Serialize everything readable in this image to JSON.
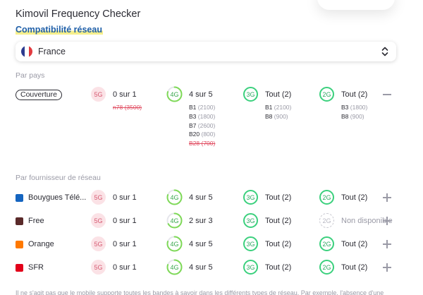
{
  "header": {
    "title": "Kimovil Frequency Checker",
    "subtitle": "Compatibilité réseau"
  },
  "country_select": {
    "value": "France",
    "flag_colors": [
      "#2d3b8f",
      "#ffffff",
      "#e23a3f"
    ]
  },
  "by_country": {
    "section_label": "Par pays",
    "coverage_button": "Couverture",
    "g5": {
      "badge": "5G",
      "stat": "0 sur 1",
      "bands": [
        {
          "name": "n78",
          "freq": "(3500)",
          "missing": true
        }
      ]
    },
    "g4": {
      "badge": "4G",
      "stat": "4 sur 5",
      "progress": 0.8,
      "bands": [
        {
          "name": "B1",
          "freq": "(2100)",
          "missing": false
        },
        {
          "name": "B3",
          "freq": "(1800)",
          "missing": false
        },
        {
          "name": "B7",
          "freq": "(2600)",
          "missing": false
        },
        {
          "name": "B20",
          "freq": "(800)",
          "missing": false
        },
        {
          "name": "B28",
          "freq": "(700)",
          "missing": true
        }
      ]
    },
    "g3": {
      "badge": "3G",
      "stat": "Tout (2)",
      "bands": [
        {
          "name": "B1",
          "freq": "(2100)",
          "missing": false
        },
        {
          "name": "B8",
          "freq": "(900)",
          "missing": false
        }
      ]
    },
    "g2": {
      "badge": "2G",
      "stat": "Tout (2)",
      "bands": [
        {
          "name": "B3",
          "freq": "(1800)",
          "missing": false
        },
        {
          "name": "B8",
          "freq": "(900)",
          "missing": false
        }
      ]
    }
  },
  "by_operator": {
    "section_label": "Par fournisseur de réseau",
    "operators": [
      {
        "name": "Bouygues Télé...",
        "logo_color": "#1565c0",
        "g5": {
          "badge": "5G",
          "stat": "0 sur 1"
        },
        "g4": {
          "badge": "4G",
          "stat": "4 sur 5",
          "progress": 0.8
        },
        "g3": {
          "badge": "3G",
          "stat": "Tout (2)"
        },
        "g2": {
          "badge": "2G",
          "stat": "Tout (2)",
          "available": true
        }
      },
      {
        "name": "Free",
        "logo_color": "#5a2a2a",
        "g5": {
          "badge": "5G",
          "stat": "0 sur 1"
        },
        "g4": {
          "badge": "4G",
          "stat": "2 sur 3",
          "progress": 0.667
        },
        "g3": {
          "badge": "3G",
          "stat": "Tout (2)"
        },
        "g2": {
          "badge": "2G",
          "stat": "Non disponible",
          "available": false
        }
      },
      {
        "name": "Orange",
        "logo_color": "#ff7900",
        "g5": {
          "badge": "5G",
          "stat": "0 sur 1"
        },
        "g4": {
          "badge": "4G",
          "stat": "4 sur 5",
          "progress": 0.8
        },
        "g3": {
          "badge": "3G",
          "stat": "Tout (2)"
        },
        "g2": {
          "badge": "2G",
          "stat": "Tout (2)",
          "available": true
        }
      },
      {
        "name": "SFR",
        "logo_color": "#e2001a",
        "g5": {
          "badge": "5G",
          "stat": "0 sur 1"
        },
        "g4": {
          "badge": "4G",
          "stat": "4 sur 5",
          "progress": 0.8
        },
        "g3": {
          "badge": "3G",
          "stat": "Tout (2)"
        },
        "g2": {
          "badge": "2G",
          "stat": "Tout (2)",
          "available": true
        }
      }
    ]
  },
  "footnote": "Il ne s'agit pas que le mobile supporte toutes les bandes à savoir dans les différents types de réseau. Par exemple, l'absence d'une"
}
